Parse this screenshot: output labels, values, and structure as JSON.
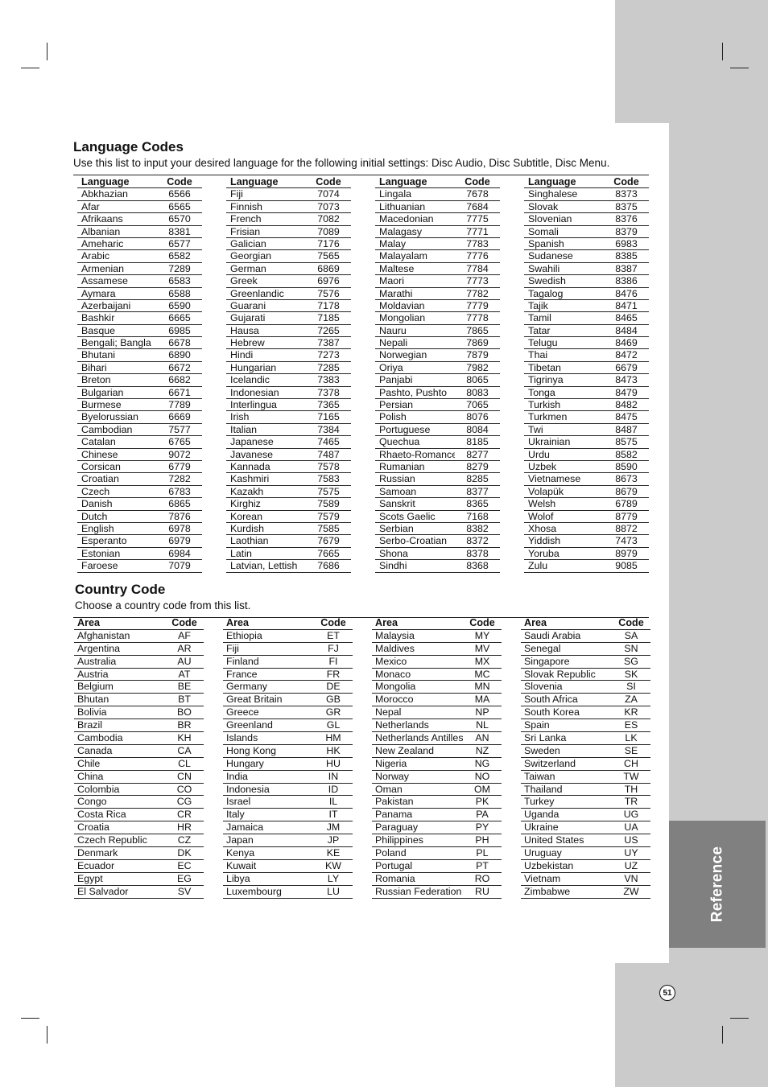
{
  "sidebar": {
    "section_tab": "Reference",
    "page_number": "51"
  },
  "language_section": {
    "title": "Language Codes",
    "description": "Use this list to input your desired language for the following initial settings: Disc Audio, Disc Subtitle, Disc Menu.",
    "header": {
      "name": "Language",
      "code": "Code"
    },
    "columns": [
      [
        [
          "Abkhazian",
          "6566"
        ],
        [
          "Afar",
          "6565"
        ],
        [
          "Afrikaans",
          "6570"
        ],
        [
          "Albanian",
          "8381"
        ],
        [
          "Ameharic",
          "6577"
        ],
        [
          "Arabic",
          "6582"
        ],
        [
          "Armenian",
          "7289"
        ],
        [
          "Assamese",
          "6583"
        ],
        [
          "Aymara",
          "6588"
        ],
        [
          "Azerbaijani",
          "6590"
        ],
        [
          "Bashkir",
          "6665"
        ],
        [
          "Basque",
          "6985"
        ],
        [
          "Bengali; Bangla",
          "6678"
        ],
        [
          "Bhutani",
          "6890"
        ],
        [
          "Bihari",
          "6672"
        ],
        [
          "Breton",
          "6682"
        ],
        [
          "Bulgarian",
          "6671"
        ],
        [
          "Burmese",
          "7789"
        ],
        [
          "Byelorussian",
          "6669"
        ],
        [
          "Cambodian",
          "7577"
        ],
        [
          "Catalan",
          "6765"
        ],
        [
          "Chinese",
          "9072"
        ],
        [
          "Corsican",
          "6779"
        ],
        [
          "Croatian",
          "7282"
        ],
        [
          "Czech",
          "6783"
        ],
        [
          "Danish",
          "6865"
        ],
        [
          "Dutch",
          "7876"
        ],
        [
          "English",
          "6978"
        ],
        [
          "Esperanto",
          "6979"
        ],
        [
          "Estonian",
          "6984"
        ],
        [
          "Faroese",
          "7079"
        ]
      ],
      [
        [
          "Fiji",
          "7074"
        ],
        [
          "Finnish",
          "7073"
        ],
        [
          "French",
          "7082"
        ],
        [
          "Frisian",
          "7089"
        ],
        [
          "Galician",
          "7176"
        ],
        [
          "Georgian",
          "7565"
        ],
        [
          "German",
          "6869"
        ],
        [
          "Greek",
          "6976"
        ],
        [
          "Greenlandic",
          "7576"
        ],
        [
          "Guarani",
          "7178"
        ],
        [
          "Gujarati",
          "7185"
        ],
        [
          "Hausa",
          "7265"
        ],
        [
          "Hebrew",
          "7387"
        ],
        [
          "Hindi",
          "7273"
        ],
        [
          "Hungarian",
          "7285"
        ],
        [
          "Icelandic",
          "7383"
        ],
        [
          "Indonesian",
          "7378"
        ],
        [
          "Interlingua",
          "7365"
        ],
        [
          "Irish",
          "7165"
        ],
        [
          "Italian",
          "7384"
        ],
        [
          "Japanese",
          "7465"
        ],
        [
          "Javanese",
          "7487"
        ],
        [
          "Kannada",
          "7578"
        ],
        [
          "Kashmiri",
          "7583"
        ],
        [
          "Kazakh",
          "7575"
        ],
        [
          "Kirghiz",
          "7589"
        ],
        [
          "Korean",
          "7579"
        ],
        [
          "Kurdish",
          "7585"
        ],
        [
          "Laothian",
          "7679"
        ],
        [
          "Latin",
          "7665"
        ],
        [
          "Latvian, Lettish",
          "7686"
        ]
      ],
      [
        [
          "Lingala",
          "7678"
        ],
        [
          "Lithuanian",
          "7684"
        ],
        [
          "Macedonian",
          "7775"
        ],
        [
          "Malagasy",
          "7771"
        ],
        [
          "Malay",
          "7783"
        ],
        [
          "Malayalam",
          "7776"
        ],
        [
          "Maltese",
          "7784"
        ],
        [
          "Maori",
          "7773"
        ],
        [
          "Marathi",
          "7782"
        ],
        [
          "Moldavian",
          "7779"
        ],
        [
          "Mongolian",
          "7778"
        ],
        [
          "Nauru",
          "7865"
        ],
        [
          "Nepali",
          "7869"
        ],
        [
          "Norwegian",
          "7879"
        ],
        [
          "Oriya",
          "7982"
        ],
        [
          "Panjabi",
          "8065"
        ],
        [
          "Pashto, Pushto",
          "8083"
        ],
        [
          "Persian",
          "7065"
        ],
        [
          "Polish",
          "8076"
        ],
        [
          "Portuguese",
          "8084"
        ],
        [
          "Quechua",
          "8185"
        ],
        [
          "Rhaeto-Romance",
          "8277"
        ],
        [
          "Rumanian",
          "8279"
        ],
        [
          "Russian",
          "8285"
        ],
        [
          "Samoan",
          "8377"
        ],
        [
          "Sanskrit",
          "8365"
        ],
        [
          "Scots Gaelic",
          "7168"
        ],
        [
          "Serbian",
          "8382"
        ],
        [
          "Serbo-Croatian",
          "8372"
        ],
        [
          "Shona",
          "8378"
        ],
        [
          "Sindhi",
          "8368"
        ]
      ],
      [
        [
          "Singhalese",
          "8373"
        ],
        [
          "Slovak",
          "8375"
        ],
        [
          "Slovenian",
          "8376"
        ],
        [
          "Somali",
          "8379"
        ],
        [
          "Spanish",
          "6983"
        ],
        [
          "Sudanese",
          "8385"
        ],
        [
          "Swahili",
          "8387"
        ],
        [
          "Swedish",
          "8386"
        ],
        [
          "Tagalog",
          "8476"
        ],
        [
          "Tajik",
          "8471"
        ],
        [
          "Tamil",
          "8465"
        ],
        [
          "Tatar",
          "8484"
        ],
        [
          "Telugu",
          "8469"
        ],
        [
          "Thai",
          "8472"
        ],
        [
          "Tibetan",
          "6679"
        ],
        [
          "Tigrinya",
          "8473"
        ],
        [
          "Tonga",
          "8479"
        ],
        [
          "Turkish",
          "8482"
        ],
        [
          "Turkmen",
          "8475"
        ],
        [
          "Twi",
          "8487"
        ],
        [
          "Ukrainian",
          "8575"
        ],
        [
          "Urdu",
          "8582"
        ],
        [
          "Uzbek",
          "8590"
        ],
        [
          "Vietnamese",
          "8673"
        ],
        [
          "Volapük",
          "8679"
        ],
        [
          "Welsh",
          "6789"
        ],
        [
          "Wolof",
          "8779"
        ],
        [
          "Xhosa",
          "8872"
        ],
        [
          "Yiddish",
          "7473"
        ],
        [
          "Yoruba",
          "8979"
        ],
        [
          "Zulu",
          "9085"
        ]
      ]
    ]
  },
  "country_section": {
    "title": "Country Code",
    "description": "Choose a country code  from this list.",
    "header": {
      "name": "Area",
      "code": "Code"
    },
    "columns": [
      [
        [
          "Afghanistan",
          "AF"
        ],
        [
          "Argentina",
          "AR"
        ],
        [
          "Australia",
          "AU"
        ],
        [
          "Austria",
          "AT"
        ],
        [
          "Belgium",
          "BE"
        ],
        [
          "Bhutan",
          "BT"
        ],
        [
          "Bolivia",
          "BO"
        ],
        [
          "Brazil",
          "BR"
        ],
        [
          "Cambodia",
          "KH"
        ],
        [
          "Canada",
          "CA"
        ],
        [
          "Chile",
          "CL"
        ],
        [
          "China",
          "CN"
        ],
        [
          "Colombia",
          "CO"
        ],
        [
          "Congo",
          "CG"
        ],
        [
          "Costa Rica",
          "CR"
        ],
        [
          "Croatia",
          "HR"
        ],
        [
          "Czech Republic",
          "CZ"
        ],
        [
          "Denmark",
          "DK"
        ],
        [
          "Ecuador",
          "EC"
        ],
        [
          "Egypt",
          "EG"
        ],
        [
          "El Salvador",
          "SV"
        ]
      ],
      [
        [
          "Ethiopia",
          "ET"
        ],
        [
          "Fiji",
          "FJ"
        ],
        [
          "Finland",
          "FI"
        ],
        [
          "France",
          "FR"
        ],
        [
          "Germany",
          "DE"
        ],
        [
          "Great Britain",
          "GB"
        ],
        [
          "Greece",
          "GR"
        ],
        [
          "Greenland",
          "GL"
        ],
        [
          "Islands",
          "HM"
        ],
        [
          "Hong Kong",
          "HK"
        ],
        [
          "Hungary",
          "HU"
        ],
        [
          "India",
          "IN"
        ],
        [
          "Indonesia",
          "ID"
        ],
        [
          "Israel",
          "IL"
        ],
        [
          "Italy",
          "IT"
        ],
        [
          "Jamaica",
          "JM"
        ],
        [
          "Japan",
          "JP"
        ],
        [
          "Kenya",
          "KE"
        ],
        [
          "Kuwait",
          "KW"
        ],
        [
          "Libya",
          "LY"
        ],
        [
          "Luxembourg",
          "LU"
        ]
      ],
      [
        [
          "Malaysia",
          "MY"
        ],
        [
          "Maldives",
          "MV"
        ],
        [
          "Mexico",
          "MX"
        ],
        [
          "Monaco",
          "MC"
        ],
        [
          "Mongolia",
          "MN"
        ],
        [
          "Morocco",
          "MA"
        ],
        [
          "Nepal",
          "NP"
        ],
        [
          "Netherlands",
          "NL"
        ],
        [
          "Netherlands Antilles",
          "AN"
        ],
        [
          "New Zealand",
          "NZ"
        ],
        [
          "Nigeria",
          "NG"
        ],
        [
          "Norway",
          "NO"
        ],
        [
          "Oman",
          "OM"
        ],
        [
          "Pakistan",
          "PK"
        ],
        [
          "Panama",
          "PA"
        ],
        [
          "Paraguay",
          "PY"
        ],
        [
          "Philippines",
          "PH"
        ],
        [
          "Poland",
          "PL"
        ],
        [
          "Portugal",
          "PT"
        ],
        [
          "Romania",
          "RO"
        ],
        [
          "Russian Federation",
          "RU"
        ]
      ],
      [
        [
          "Saudi Arabia",
          "SA"
        ],
        [
          "Senegal",
          "SN"
        ],
        [
          "Singapore",
          "SG"
        ],
        [
          "Slovak Republic",
          "SK"
        ],
        [
          "Slovenia",
          "SI"
        ],
        [
          "South Africa",
          "ZA"
        ],
        [
          "South Korea",
          "KR"
        ],
        [
          "Spain",
          "ES"
        ],
        [
          "Sri Lanka",
          "LK"
        ],
        [
          "Sweden",
          "SE"
        ],
        [
          "Switzerland",
          "CH"
        ],
        [
          "Taiwan",
          "TW"
        ],
        [
          "Thailand",
          "TH"
        ],
        [
          "Turkey",
          "TR"
        ],
        [
          "Uganda",
          "UG"
        ],
        [
          "Ukraine",
          "UA"
        ],
        [
          "United States",
          "US"
        ],
        [
          "Uruguay",
          "UY"
        ],
        [
          "Uzbekistan",
          "UZ"
        ],
        [
          "Vietnam",
          "VN"
        ],
        [
          "Zimbabwe",
          "ZW"
        ]
      ]
    ]
  }
}
